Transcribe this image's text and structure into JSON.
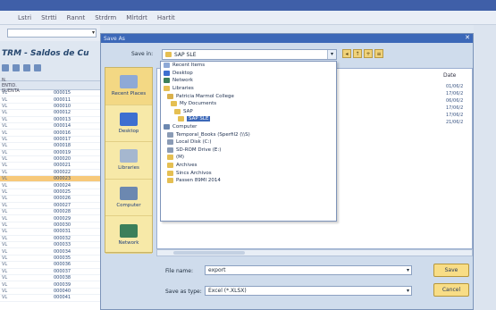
{
  "app": {
    "menus": [
      "Lstri",
      "Strtti",
      "Rannt",
      "Strdrm",
      "Mlrtdrt",
      "Hartit"
    ],
    "title": "TRM - Saldos de Cu",
    "grid_header": [
      "N. ENTID. SUENTA"
    ],
    "grid_rows": [
      {
        "a": "VL",
        "b": "000015",
        "sel": false
      },
      {
        "a": "VL",
        "b": "000011",
        "sel": false
      },
      {
        "a": "VL",
        "b": "000010",
        "sel": false
      },
      {
        "a": "VL",
        "b": "000012",
        "sel": false
      },
      {
        "a": "VL",
        "b": "000013",
        "sel": false
      },
      {
        "a": "VL",
        "b": "000014",
        "sel": false
      },
      {
        "a": "VL",
        "b": "000016",
        "sel": false
      },
      {
        "a": "VL",
        "b": "000017",
        "sel": false
      },
      {
        "a": "VL",
        "b": "000018",
        "sel": false
      },
      {
        "a": "VL",
        "b": "000019",
        "sel": false
      },
      {
        "a": "VL",
        "b": "000020",
        "sel": false
      },
      {
        "a": "VL",
        "b": "000021",
        "sel": false
      },
      {
        "a": "VL",
        "b": "000022",
        "sel": false
      },
      {
        "a": "VL",
        "b": "000023",
        "sel": true
      },
      {
        "a": "VL",
        "b": "000024",
        "sel": false
      },
      {
        "a": "VL",
        "b": "000025",
        "sel": false
      },
      {
        "a": "VL",
        "b": "000026",
        "sel": false
      },
      {
        "a": "VL",
        "b": "000027",
        "sel": false
      },
      {
        "a": "VL",
        "b": "000028",
        "sel": false
      },
      {
        "a": "VL",
        "b": "000029",
        "sel": false
      },
      {
        "a": "VL",
        "b": "000030",
        "sel": false
      },
      {
        "a": "VL",
        "b": "000031",
        "sel": false
      },
      {
        "a": "VL",
        "b": "000032",
        "sel": false
      },
      {
        "a": "VL",
        "b": "000033",
        "sel": false
      },
      {
        "a": "VL",
        "b": "000034",
        "sel": false
      },
      {
        "a": "VL",
        "b": "000035",
        "sel": false
      },
      {
        "a": "VL",
        "b": "000036",
        "sel": false
      },
      {
        "a": "VL",
        "b": "000037",
        "sel": false
      },
      {
        "a": "VL",
        "b": "000038",
        "sel": false
      },
      {
        "a": "VL",
        "b": "000039",
        "sel": false
      },
      {
        "a": "VL",
        "b": "000040",
        "sel": false
      },
      {
        "a": "VL",
        "b": "000041",
        "sel": false
      }
    ]
  },
  "dialog": {
    "title": "Save As",
    "close": "✕",
    "save_in_label": "Save in:",
    "save_in_value": "SAP SLE",
    "places": [
      {
        "label": "Recent Places",
        "color": "#8ea9d6"
      },
      {
        "label": "Desktop",
        "color": "#3d6fd0"
      },
      {
        "label": "Libraries",
        "color": "#a5b7cf"
      },
      {
        "label": "Computer",
        "color": "#6c88b0"
      },
      {
        "label": "Network",
        "color": "#3b7f5a"
      }
    ],
    "date_header": "Date",
    "dates": [
      "01/06/2",
      "17/06/2",
      "06/06/2",
      "17/06/2",
      "17/06/2",
      "21/06/2"
    ],
    "dropdown_items": [
      {
        "label": "Recent Items",
        "indent": 0,
        "color": "#8ea9d6"
      },
      {
        "label": "Desktop",
        "indent": 0,
        "color": "#3d6fd0"
      },
      {
        "label": "Network",
        "indent": 0,
        "color": "#3b7f5a"
      },
      {
        "label": "Libraries",
        "indent": 0,
        "color": "#e5bf52"
      },
      {
        "label": "Patricia Marmol College",
        "indent": 4,
        "color": "#d9b04c"
      },
      {
        "label": "My Documents",
        "indent": 8,
        "color": "#e5bf52"
      },
      {
        "label": "SAP",
        "indent": 12,
        "color": "#e5bf52"
      },
      {
        "label": "SAP SLE",
        "indent": 16,
        "color": "#e5bf52",
        "sel": true
      },
      {
        "label": "Computer",
        "indent": 0,
        "color": "#6c88b0"
      },
      {
        "label": "Temporal_Books (Sperfil2 (\\\\S)",
        "indent": 4,
        "color": "#8a9bb5"
      },
      {
        "label": "Local Disk (C:)",
        "indent": 4,
        "color": "#8a9bb5"
      },
      {
        "label": "SD-ROM Drive (E:)",
        "indent": 4,
        "color": "#8a9bb5"
      },
      {
        "label": "(M)",
        "indent": 4,
        "color": "#e5bf52"
      },
      {
        "label": "Archives",
        "indent": 4,
        "color": "#e5bf52"
      },
      {
        "label": "Sincs Archivos",
        "indent": 4,
        "color": "#e5bf52"
      },
      {
        "label": "Passen 89MI 2014",
        "indent": 4,
        "color": "#e5bf52"
      }
    ],
    "filename_label": "File name:",
    "filename_value": "export",
    "filetype_label": "Save as type:",
    "filetype_value": "Excel (*.XLSX)",
    "save_label": "Save",
    "cancel_label": "Cancel"
  },
  "colors": {
    "title_bar": "#3c68b8",
    "places_bg": "#f7e9a8",
    "selection": "#3c68b8",
    "row_highlight": "#f7c97a"
  }
}
